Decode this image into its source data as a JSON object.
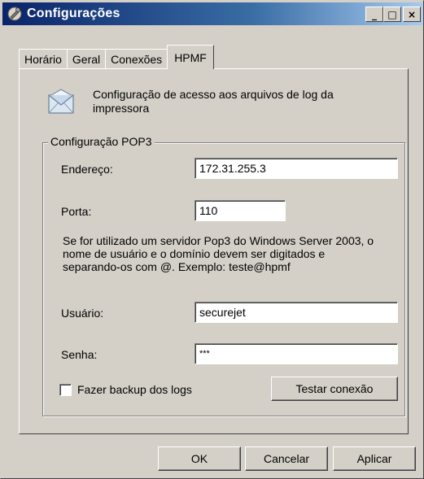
{
  "window": {
    "title": "Configurações",
    "minimize_glyph": "_",
    "maximize_glyph": "□",
    "close_glyph": "×"
  },
  "tabs": [
    {
      "label": "Horário",
      "active": false
    },
    {
      "label": "Geral",
      "active": false
    },
    {
      "label": "Conexões",
      "active": false
    },
    {
      "label": "HPMF",
      "active": true
    }
  ],
  "panel": {
    "description": "Configuração de acesso aos arquivos de log da impressora",
    "icon": "envelope-icon",
    "group": {
      "title": "Configuração POP3",
      "address_label": "Endereço:",
      "address_value": "172.31.255.3",
      "port_label": "Porta:",
      "port_value": "110",
      "note": "Se for utilizado um servidor Pop3 do Windows Server 2003, o nome de usuário e o domínio devem ser digitados e separando-os com @. Exemplo: teste@hpmf",
      "user_label": "Usuário:",
      "user_value": "securejet",
      "password_label": "Senha:",
      "password_value": "***",
      "backup_label": "Fazer backup dos logs",
      "backup_checked": false,
      "test_button": "Testar conexão"
    }
  },
  "buttons": {
    "ok": "OK",
    "cancel": "Cancelar",
    "apply": "Aplicar"
  },
  "colors": {
    "titlebar_start": "#0a246a",
    "titlebar_end": "#a6caf0",
    "face": "#d4d0c8"
  }
}
